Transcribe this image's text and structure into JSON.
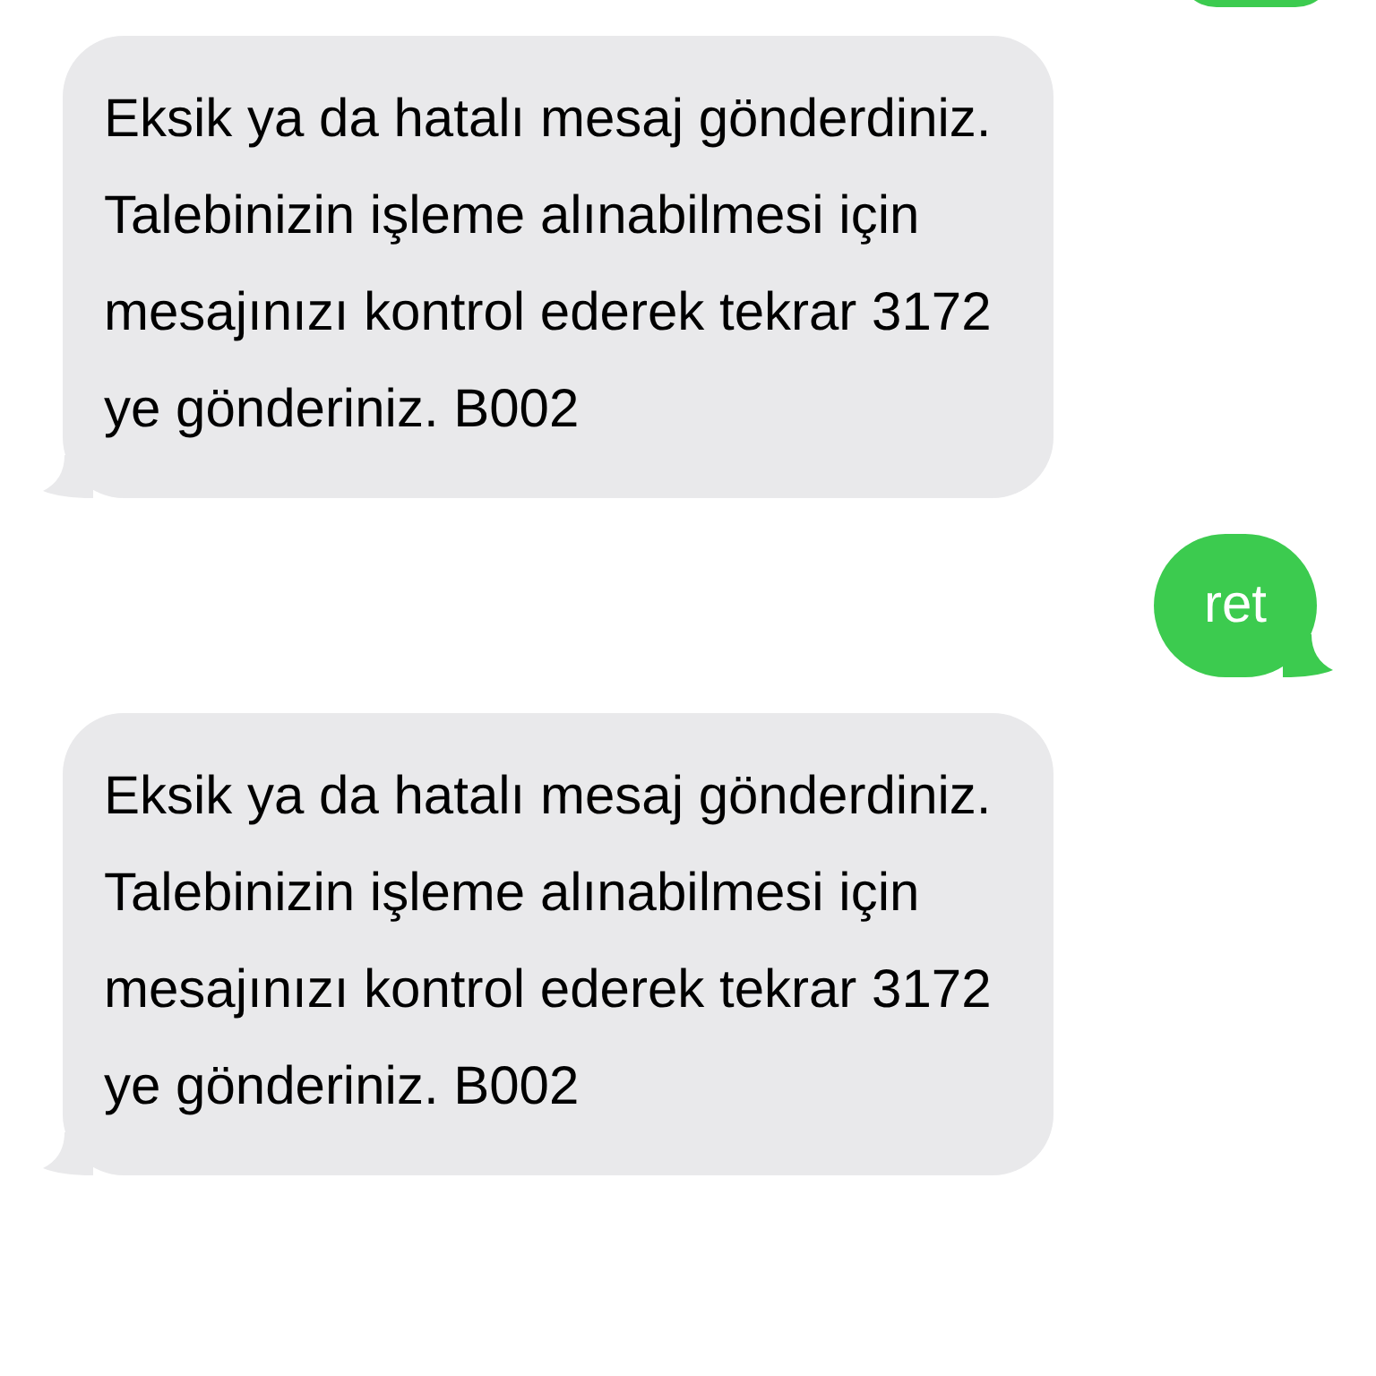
{
  "messages": [
    {
      "kind": "received",
      "text": "Eksik ya da hatalı mesaj gönderdiniz. Talebinizin işleme alınabilmesi için mesajınızı kontrol ederek tekrar 3172 ye gönderiniz. B002"
    },
    {
      "kind": "sent",
      "text": "ret"
    },
    {
      "kind": "received",
      "text": "Eksik ya da hatalı mesaj gönderdiniz. Talebinizin işleme alınabilmesi için mesajınızı kontrol ederek tekrar 3172 ye gönderiniz. B002"
    }
  ]
}
